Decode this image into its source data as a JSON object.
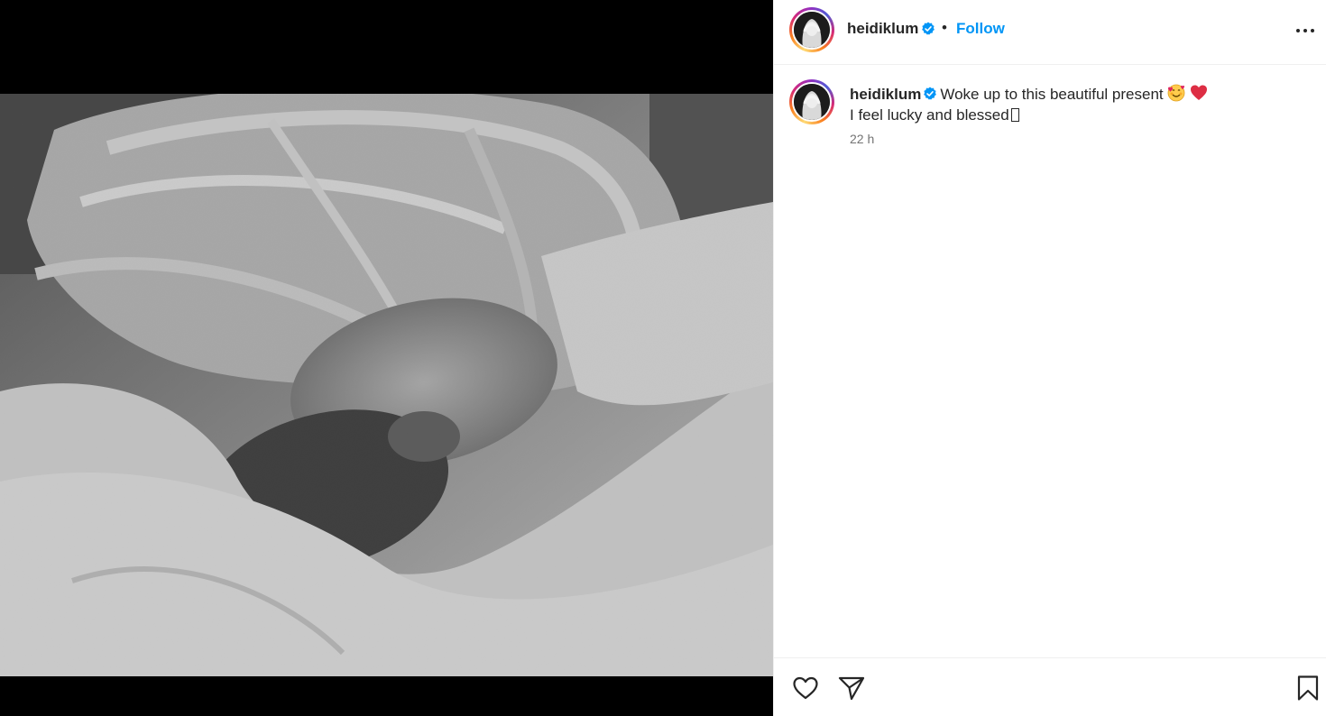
{
  "post": {
    "username": "heidiklum",
    "follow_label": "Follow",
    "separator": "•",
    "caption_line1": "Woke up to this beautiful present",
    "caption_line2": "I feel lucky and blessed",
    "timestamp": "22 h",
    "verified": true
  },
  "icons": {
    "header": [
      "avatar",
      "verified-badge-icon",
      "more-options-icon"
    ],
    "caption": [
      "smiling-face-with-hearts-icon",
      "red-heart-icon"
    ],
    "actions": [
      "like-heart-icon",
      "share-paper-plane-icon",
      "save-bookmark-icon"
    ]
  },
  "colors": {
    "accent": "#0095f6",
    "text": "#262626",
    "muted": "#737373",
    "divider": "#efefef",
    "media_background": "#000000"
  }
}
